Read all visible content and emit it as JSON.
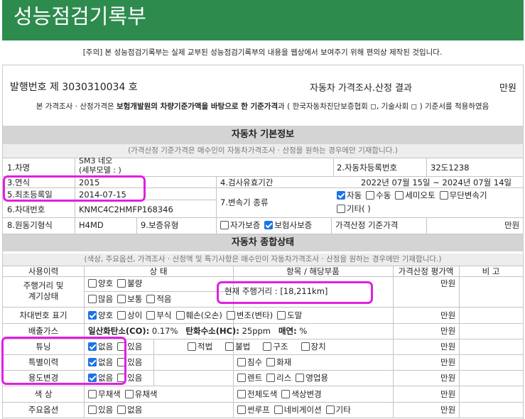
{
  "title": "성능점검기록부",
  "notice": "[주의] 본 성능점검기록부는 실제 교부된 성능점검기록부의 내용을 웹상에서 보여주기 위해 편의상 제작된 것입니다.",
  "issue_label": "발행번호 제 3030310034 호",
  "result_title": "자동차 가격조사.산정 결과",
  "won": "만원",
  "basis_prefix": "본 가격조사 · 산정가격은 ",
  "basis_bold": "보험개발원의 차량기준가액을 바탕으로 한 기준가격",
  "basis_suffix": "과 ( 한국자동차진단보증협회 ◻, 기술사회 ◻ ) 기준서를 적용하였음",
  "basic": {
    "title": "자동차 기본정보",
    "note": "(가격산정 기준가격은 매수인이 자동차가격조사 · 산정을 원하는 경우에만 기재합니다.)",
    "car_name_label": "1.차명",
    "car_name": "SM3 네오",
    "car_name_detail": "(세부모델 : )",
    "reg_no_label": "2.자동차등록번호",
    "reg_no": "32도1238",
    "year_label": "3.연식",
    "year": "2015",
    "inspect_label": "4.검사유효기간",
    "inspect": "2022년 07월 15일 ~ 2024년 07월 14일",
    "first_reg_label": "5.최초등록일",
    "first_reg": "2014-07-15",
    "trans_label": "7.변속기 종류",
    "trans_opts": [
      {
        "label": "자동",
        "checked": true
      },
      {
        "label": "수동",
        "checked": false
      },
      {
        "label": "세미오토",
        "checked": false
      },
      {
        "label": "무단변속기",
        "checked": false
      },
      {
        "label": "기타( )",
        "checked": false
      }
    ],
    "vin_label": "6.차대번호",
    "vin": "KNMC4C2HMFP168346",
    "engine_label": "8.원동기형식",
    "engine": "H4MD",
    "warranty_label": "9.보증유형",
    "warranty_opts": [
      {
        "label": "자가보증",
        "checked": false
      },
      {
        "label": "보험사보증",
        "checked": true
      }
    ],
    "price_base_label": "가격산정 기준가격",
    "price_base_unit": "만원"
  },
  "status": {
    "title": "자동차 종합상태",
    "note": "(색상, 주요옵션, 가격조사 · 산정액 및 특기사항은 매수인이 자동차가격조사 · 산정을 원하는 경우에만 기재합니다.)",
    "headers": [
      "사용이력",
      "상 태",
      "항목 / 해당부품",
      "가격산정 평가액",
      "비 고"
    ],
    "mileage": {
      "label": "주행거리 및\n계기상태",
      "row1": [
        {
          "label": "양호",
          "checked": false
        },
        {
          "label": "불량",
          "checked": false
        }
      ],
      "row2": [
        {
          "label": "많음",
          "checked": false
        },
        {
          "label": "보통",
          "checked": false
        },
        {
          "label": "적음",
          "checked": false
        }
      ],
      "item": "현재 주행거리 : [18,211km]",
      "unit": "만원"
    },
    "vin_mark": {
      "label": "차대번호 표기",
      "opts": [
        {
          "label": "양호",
          "checked": true
        },
        {
          "label": "상이",
          "checked": false
        },
        {
          "label": "부식",
          "checked": false
        },
        {
          "label": "훼손(오손)",
          "checked": false
        },
        {
          "label": "변조(변타)",
          "checked": false
        },
        {
          "label": "도말",
          "checked": false
        }
      ],
      "unit": "만원"
    },
    "emission": {
      "label": "배출가스",
      "co_label": "일산화탄소(CO):",
      "co": "0.17%",
      "hc_label": "탄화수소(HC):",
      "hc": "25ppm",
      "smoke_label": "매연:",
      "smoke": "%",
      "unit": "만원"
    },
    "tuning": {
      "label": "튜닝",
      "opts": [
        {
          "label": "없음",
          "checked": true
        },
        {
          "label": "있음",
          "checked": false
        }
      ],
      "items": [
        {
          "label": "적법",
          "checked": false
        },
        {
          "label": "불법",
          "checked": false
        },
        {
          "label": "구조",
          "checked": false
        },
        {
          "label": "장치",
          "checked": false
        }
      ],
      "unit": "만원"
    },
    "special": {
      "label": "특별이력",
      "opts": [
        {
          "label": "없음",
          "checked": true
        },
        {
          "label": "있음",
          "checked": false
        }
      ],
      "items": [
        {
          "label": "침수",
          "checked": false
        },
        {
          "label": "화재",
          "checked": false
        }
      ],
      "unit": "만원"
    },
    "usage": {
      "label": "용도변경",
      "opts": [
        {
          "label": "없음",
          "checked": true
        },
        {
          "label": "있음",
          "checked": false
        }
      ],
      "items": [
        {
          "label": "렌트",
          "checked": false
        },
        {
          "label": "리스",
          "checked": false
        },
        {
          "label": "영업용",
          "checked": false
        }
      ],
      "unit": "만원"
    },
    "color": {
      "label": "색 상",
      "opts": [
        {
          "label": "무채색",
          "checked": false
        },
        {
          "label": "유채색",
          "checked": false
        }
      ],
      "items": [
        {
          "label": "전체도색",
          "checked": false
        },
        {
          "label": "색상변경",
          "checked": false
        }
      ],
      "unit": "만원"
    },
    "options": {
      "label": "주요옵션",
      "opts": [
        {
          "label": "있음",
          "checked": false
        },
        {
          "label": "없음",
          "checked": false
        }
      ],
      "items": [
        {
          "label": "썬루프",
          "checked": false
        },
        {
          "label": "네비게이션",
          "checked": false
        },
        {
          "label": "기타",
          "checked": false
        }
      ],
      "unit": "만원"
    }
  },
  "colors": {
    "header_bg": "#2e8b4e",
    "highlight": "#e020e0",
    "checkbox_on": "#1a73e8"
  }
}
